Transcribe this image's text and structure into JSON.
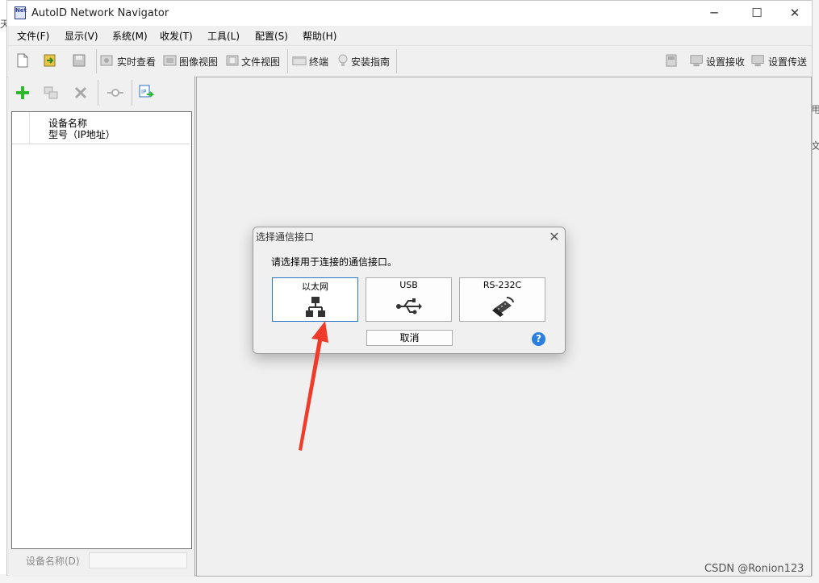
{
  "window": {
    "title": "AutoID Network Navigator"
  },
  "menu": [
    "文件(F)",
    "显示(V)",
    "系统(M)",
    "收发(T)",
    "工具(L)",
    "配置(S)",
    "帮助(H)"
  ],
  "toolbar": {
    "realtime": "实时查看",
    "image_view": "图像视图",
    "file_view": "文件视图",
    "terminal": "终端",
    "install_guide": "安装指南",
    "set_receive": "设置接收",
    "set_transfer": "设置传送"
  },
  "device_list": {
    "header_line1": "设备名称",
    "header_line2": "型号（IP地址）",
    "name_label": "设备名称(D)"
  },
  "dialog": {
    "title": "选择通信接口",
    "prompt": "请选择用于连接的通信接口。",
    "options": [
      "以太网",
      "USB",
      "RS-232C"
    ],
    "cancel": "取消",
    "help": "?"
  },
  "background": {
    "left_char": "天",
    "right_char1": "用",
    "right_char2": "文"
  },
  "watermark": "CSDN @Ronion123",
  "colors": {
    "accent": "#2a77c9",
    "arrow": "#f03a2a",
    "help": "#2a7fe0"
  }
}
